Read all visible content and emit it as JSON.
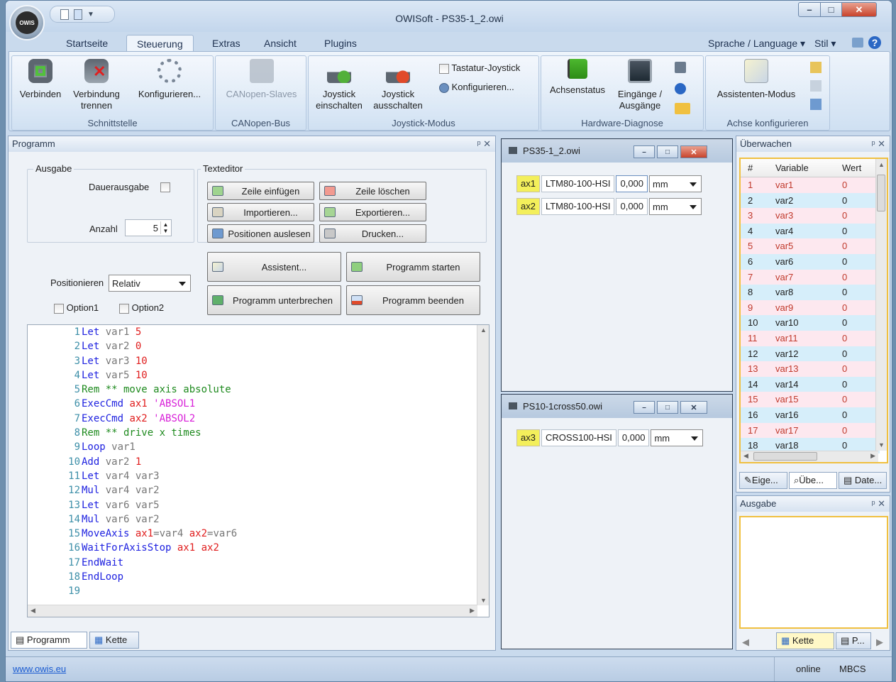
{
  "window": {
    "title": "OWISoft - PS35-1_2.owi",
    "logo_text": "OWIS"
  },
  "ribbon": {
    "tabs": [
      "Startseite",
      "Steuerung",
      "Extras",
      "Ansicht",
      "Plugins"
    ],
    "active_tab": "Steuerung",
    "right_items": {
      "language": "Sprache / Language",
      "style": "Stil"
    },
    "groups": [
      {
        "label": "Schnittstelle",
        "buttons": [
          "Verbinden",
          "Verbindung trennen",
          "Konfigurieren..."
        ]
      },
      {
        "label": "CANopen-Bus",
        "buttons": [
          "CANopen-Slaves"
        ]
      },
      {
        "label": "Joystick-Modus",
        "buttons": [
          "Joystick einschalten",
          "Joystick ausschalten"
        ],
        "checkbox": "Tastatur-Joystick",
        "small_button": "Konfigurieren..."
      },
      {
        "label": "Hardware-Diagnose",
        "buttons": [
          "Achsenstatus",
          "Eingänge / Ausgänge"
        ]
      },
      {
        "label": "Achse konfigurieren",
        "buttons": [
          "Assistenten-Modus"
        ]
      }
    ]
  },
  "programm": {
    "title": "Programm",
    "ausgabe": {
      "label": "Ausgabe",
      "dauerausgabe": "Dauerausgabe",
      "anzahl_label": "Anzahl",
      "anzahl_value": "5"
    },
    "texteditor": {
      "label": "Texteditor",
      "buttons": [
        "Zeile einfügen",
        "Zeile löschen",
        "Importieren...",
        "Exportieren...",
        "Positionen auslesen",
        "Drucken..."
      ]
    },
    "assistent": "Assistent...",
    "programm_starten": "Programm starten",
    "programm_unterbrechen": "Programm unterbrechen",
    "programm_beenden": "Programm beenden",
    "positionieren_label": "Positionieren",
    "positionieren_value": "Relativ",
    "option1": "Option1",
    "option2": "Option2",
    "code": [
      [
        [
          "kw",
          "Let"
        ],
        [
          "vr",
          " var1"
        ],
        [
          "nm",
          " 5"
        ]
      ],
      [
        [
          "kw",
          "Let"
        ],
        [
          "vr",
          " var2"
        ],
        [
          "nm",
          " 0"
        ]
      ],
      [
        [
          "kw",
          "Let"
        ],
        [
          "vr",
          " var3"
        ],
        [
          "nm",
          " 10"
        ]
      ],
      [
        [
          "kw",
          "Let"
        ],
        [
          "vr",
          " var5"
        ],
        [
          "nm",
          " 10"
        ]
      ],
      [
        [
          "cm",
          "Rem ** move axis absolute"
        ]
      ],
      [
        [
          "kw",
          "ExecCmd"
        ],
        [
          "nm",
          " ax1"
        ],
        [
          "st",
          " 'ABSOL1"
        ]
      ],
      [
        [
          "kw",
          "ExecCmd"
        ],
        [
          "nm",
          " ax2"
        ],
        [
          "st",
          " 'ABSOL2"
        ]
      ],
      [
        [
          "cm",
          "Rem ** drive x times"
        ]
      ],
      [
        [
          "kw",
          "Loop"
        ],
        [
          "vr",
          " var1"
        ]
      ],
      [
        [
          "kw",
          "Add"
        ],
        [
          "vr",
          " var2"
        ],
        [
          "nm",
          " 1"
        ]
      ],
      [
        [
          "kw",
          "Let"
        ],
        [
          "vr",
          " var4"
        ],
        [
          "vr",
          " var3"
        ]
      ],
      [
        [
          "kw",
          "Mul"
        ],
        [
          "vr",
          " var4"
        ],
        [
          "vr",
          " var2"
        ]
      ],
      [
        [
          "kw",
          "Let"
        ],
        [
          "vr",
          " var6"
        ],
        [
          "vr",
          " var5"
        ]
      ],
      [
        [
          "kw",
          "Mul"
        ],
        [
          "vr",
          " var6"
        ],
        [
          "vr",
          " var2"
        ]
      ],
      [
        [
          "kw",
          "MoveAxis"
        ],
        [
          "nm",
          " ax1"
        ],
        [
          "op",
          "="
        ],
        [
          "vr",
          "var4"
        ],
        [
          "nm",
          " ax2"
        ],
        [
          "op",
          "="
        ],
        [
          "vr",
          "var6"
        ]
      ],
      [
        [
          "kw",
          "WaitForAxisStop"
        ],
        [
          "nm",
          " ax1"
        ],
        [
          "nm",
          " ax2"
        ]
      ],
      [
        [
          "kw",
          "EndWait"
        ]
      ],
      [
        [
          "kw",
          "EndLoop"
        ]
      ],
      []
    ],
    "bottom_tabs": [
      "Programm",
      "Kette"
    ]
  },
  "mdi": [
    {
      "title": "PS35-1_2.owi",
      "axes": [
        {
          "name": "ax1",
          "device": "LTM80-100-HSI",
          "pos": "0,000",
          "unit": "mm"
        },
        {
          "name": "ax2",
          "device": "LTM80-100-HSI",
          "pos": "0,000",
          "unit": "mm"
        }
      ]
    },
    {
      "title": "PS10-1cross50.owi",
      "axes": [
        {
          "name": "ax3",
          "device": "CROSS100-HSI",
          "pos": "0,000",
          "unit": "mm"
        }
      ]
    }
  ],
  "watch": {
    "title": "Überwachen",
    "headers": [
      "#",
      "Variable",
      "Wert"
    ],
    "rows": [
      [
        "1",
        "var1",
        "0"
      ],
      [
        "2",
        "var2",
        "0"
      ],
      [
        "3",
        "var3",
        "0"
      ],
      [
        "4",
        "var4",
        "0"
      ],
      [
        "5",
        "var5",
        "0"
      ],
      [
        "6",
        "var6",
        "0"
      ],
      [
        "7",
        "var7",
        "0"
      ],
      [
        "8",
        "var8",
        "0"
      ],
      [
        "9",
        "var9",
        "0"
      ],
      [
        "10",
        "var10",
        "0"
      ],
      [
        "11",
        "var11",
        "0"
      ],
      [
        "12",
        "var12",
        "0"
      ],
      [
        "13",
        "var13",
        "0"
      ],
      [
        "14",
        "var14",
        "0"
      ],
      [
        "15",
        "var15",
        "0"
      ],
      [
        "16",
        "var16",
        "0"
      ],
      [
        "17",
        "var17",
        "0"
      ],
      [
        "18",
        "var18",
        "0"
      ]
    ],
    "tabs": [
      "Eige...",
      "Übe...",
      "Date..."
    ]
  },
  "ausgabe_panel": {
    "title": "Ausgabe",
    "tabs": [
      "Kette",
      "P..."
    ]
  },
  "status": {
    "link": "www.owis.eu",
    "online": "online",
    "mode": "MBCS"
  },
  "colors": {
    "pink_row": "#fde8ef",
    "blue_row": "#d6eefa",
    "highlight_yellow": "#f3ef5b",
    "ribbon_bg": "#dbe7f5"
  }
}
